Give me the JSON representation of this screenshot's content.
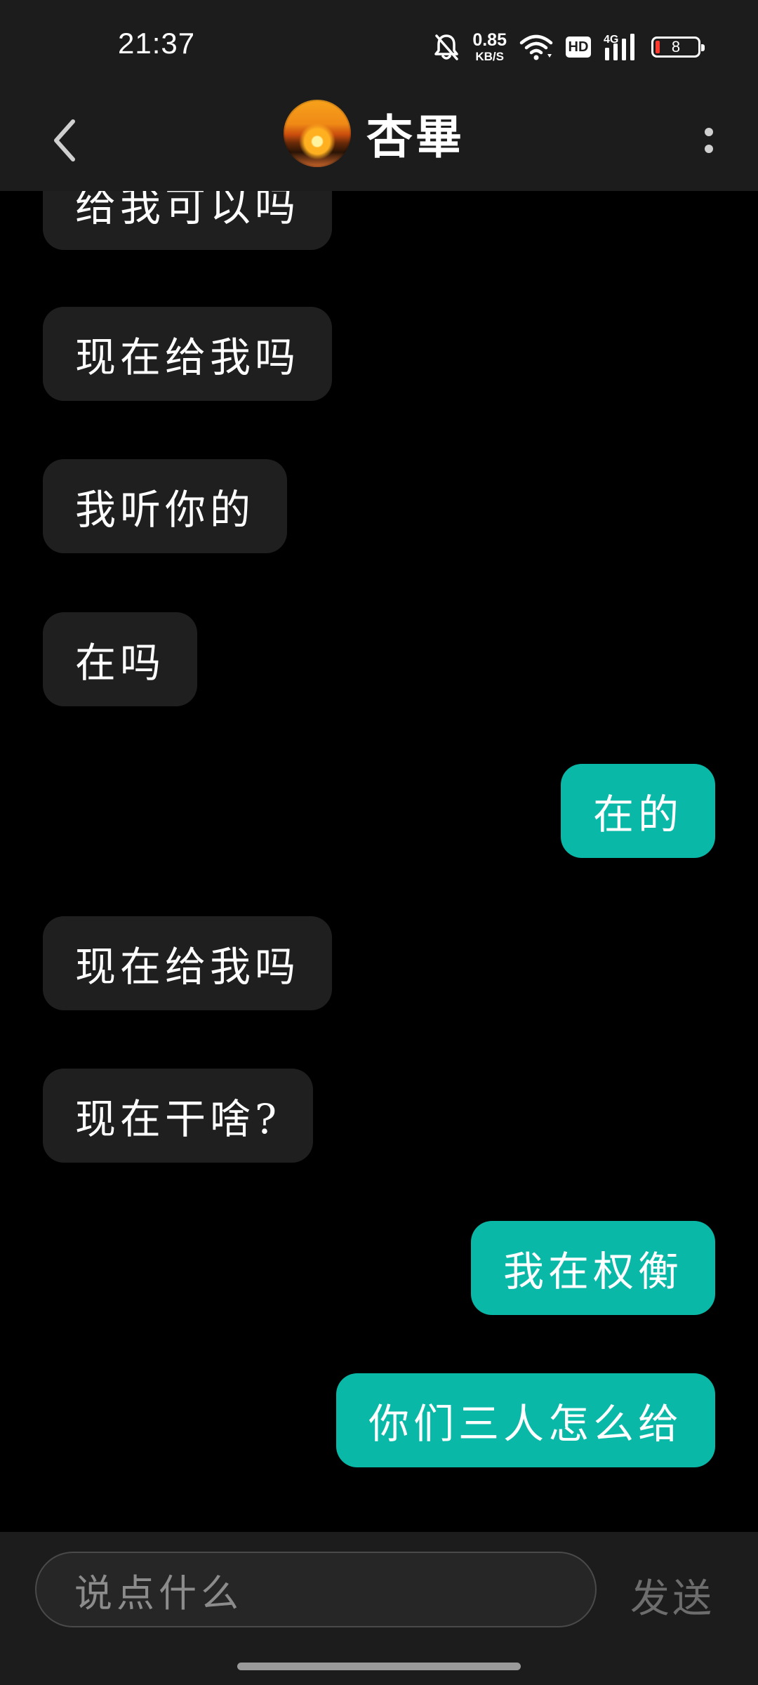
{
  "status_bar": {
    "time": "21:37",
    "net_speed_value": "0.85",
    "net_speed_unit": "KB/S",
    "hd_label": "HD",
    "network_type": "4G",
    "battery_level": "8",
    "battery_color": "#ff3b30",
    "icons": [
      "bell-muted-icon",
      "wifi-icon",
      "hd-icon",
      "signal-4g-icon",
      "battery-icon"
    ]
  },
  "header": {
    "back_icon": "chevron-left-icon",
    "contact_name": "杏畢",
    "more_icon": "more-vertical-icon"
  },
  "messages": [
    {
      "direction": "in",
      "text": "给我可以吗"
    },
    {
      "direction": "in",
      "text": "现在给我吗"
    },
    {
      "direction": "in",
      "text": "我听你的"
    },
    {
      "direction": "in",
      "text": "在吗"
    },
    {
      "direction": "out",
      "text": "在的"
    },
    {
      "direction": "in",
      "text": "现在给我吗"
    },
    {
      "direction": "in",
      "text": "现在干啥?"
    },
    {
      "direction": "out",
      "text": "我在权衡"
    },
    {
      "direction": "out",
      "text": "你们三人怎么给"
    }
  ],
  "input": {
    "placeholder": "说点什么",
    "send_label": "发送"
  },
  "colors": {
    "background": "#000000",
    "bar_background": "#1c1c1c",
    "incoming_bubble": "#1f1f1f",
    "outgoing_bubble": "#09b8a7"
  }
}
